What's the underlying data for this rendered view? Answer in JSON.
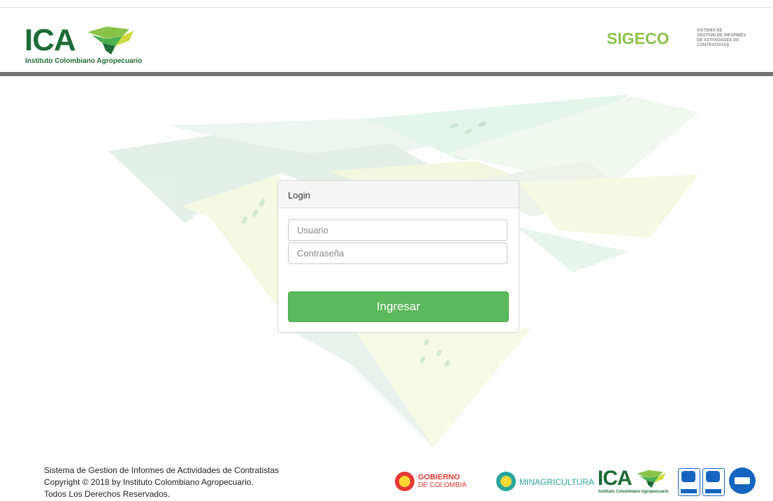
{
  "header": {
    "brand_name": "ICA",
    "brand_subtitle": "Instituto Colombiano Agropecuario",
    "app_name": "SIGECO",
    "app_description_lines": [
      "SISTEMA DE",
      "GESTION DE INFORMES",
      "DE ACTIVIDADES DE",
      "CONTRATISTAS"
    ]
  },
  "login": {
    "heading": "Login",
    "username_placeholder": "Usuario",
    "password_placeholder": "Contraseña",
    "submit_label": "Ingresar"
  },
  "footer": {
    "lines": [
      "Sistema de Gestion de Informes de Actividades de Contratistas",
      "Copyright © 2018 by Instituto Colombiano Agropecuario.",
      "Todos Los Derechos Reservados."
    ],
    "logos": {
      "gobierno_line1": "GOBIERNO",
      "gobierno_line2": "DE COLOMBIA",
      "minagricultura": "MINAGRICULTURA",
      "ica_word": "ICA",
      "ica_subtitle": "Instituto Colombiano Agropecuario"
    }
  },
  "colors": {
    "brand_green": "#1d6b37",
    "accent_green": "#8bc34a",
    "button_green": "#5cb85c",
    "header_bar_gray": "#757575"
  }
}
